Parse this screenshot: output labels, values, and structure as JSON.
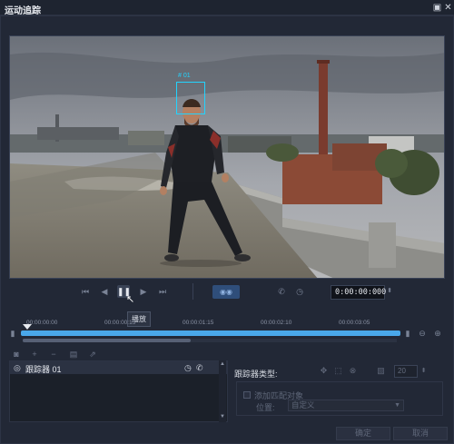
{
  "window": {
    "title": "运动追踪",
    "help_icon": "help-icon",
    "close_icon": "close-icon"
  },
  "video": {
    "tracker_label": "# 01"
  },
  "playback": {
    "timecode": "0:00:00:000",
    "tooltip": "播放",
    "buttons": [
      "skip-to-start-icon",
      "step-back-icon",
      "pause-icon",
      "step-forward-icon",
      "skip-to-end-icon"
    ],
    "speed_icon": "speed-icon",
    "phone_icon": "phone-icon",
    "clock_icon": "clock-icon"
  },
  "timeline": {
    "ticks": [
      "00:00:00:00",
      "00:00:00:15",
      "00:00:01:15",
      "00:00:02:10",
      "00:00:03:05"
    ],
    "progress": 1.0,
    "scroll_position": 0.45
  },
  "trackers": {
    "toolbar_icons": [
      "camera-icon",
      "add-icon",
      "remove-icon",
      "copy-icon",
      "export-icon"
    ],
    "items": [
      {
        "name": "跟踪器 01",
        "selected": true
      }
    ]
  },
  "properties": {
    "tracker_type_label": "跟踪器类型:",
    "spin_value": "20",
    "add_match_object_label": "添加匹配对象",
    "position_label": "位置:",
    "position_value": "自定义"
  },
  "footer": {
    "ok_label": "确定",
    "cancel_label": "取消"
  },
  "colors": {
    "accent": "#4aa8ea",
    "tracker_box": "#22d4ff"
  }
}
